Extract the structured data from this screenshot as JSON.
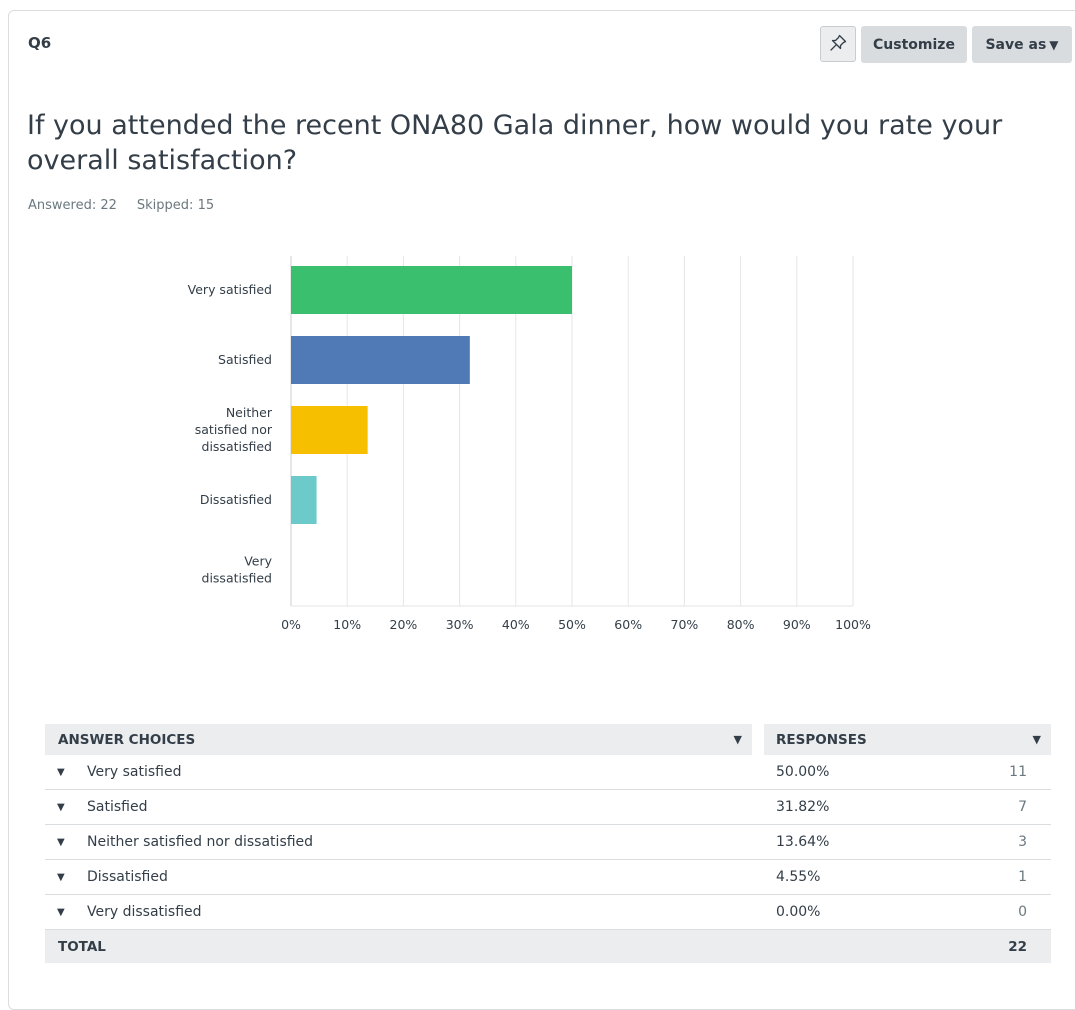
{
  "question": {
    "number": "Q6",
    "text": "If you attended the recent ONA80 Gala dinner, how would you rate your overall satisfaction?",
    "answered": "Answered: 22",
    "skipped": "Skipped: 15"
  },
  "toolbar": {
    "pin_icon": "pin-icon",
    "customize_label": "Customize",
    "save_as_label": "Save as"
  },
  "chart_data": {
    "type": "bar",
    "orientation": "horizontal",
    "categories": [
      [
        "Very satisfied"
      ],
      [
        "Satisfied"
      ],
      [
        "Neither",
        "satisfied nor",
        "dissatisfied"
      ],
      [
        "Dissatisfied"
      ],
      [
        "Very",
        "dissatisfied"
      ]
    ],
    "values": [
      50.0,
      31.82,
      13.64,
      4.55,
      0.0
    ],
    "colors": [
      "#3abf6e",
      "#4f7ab5",
      "#f6bf00",
      "#6ccacb",
      "#dddddd"
    ],
    "xlim": [
      0,
      100
    ],
    "xticks": [
      "0%",
      "10%",
      "20%",
      "30%",
      "40%",
      "50%",
      "60%",
      "70%",
      "80%",
      "90%",
      "100%"
    ],
    "grid": true,
    "legend": "none"
  },
  "table": {
    "header_choices": "ANSWER CHOICES",
    "header_responses": "RESPONSES",
    "rows": [
      {
        "choice": "Very satisfied",
        "percent": "50.00%",
        "count": "11"
      },
      {
        "choice": "Satisfied",
        "percent": "31.82%",
        "count": "7"
      },
      {
        "choice": "Neither satisfied nor dissatisfied",
        "percent": "13.64%",
        "count": "3"
      },
      {
        "choice": "Dissatisfied",
        "percent": "4.55%",
        "count": "1"
      },
      {
        "choice": "Very dissatisfied",
        "percent": "0.00%",
        "count": "0"
      }
    ],
    "total_label": "TOTAL",
    "total_count": "22"
  }
}
